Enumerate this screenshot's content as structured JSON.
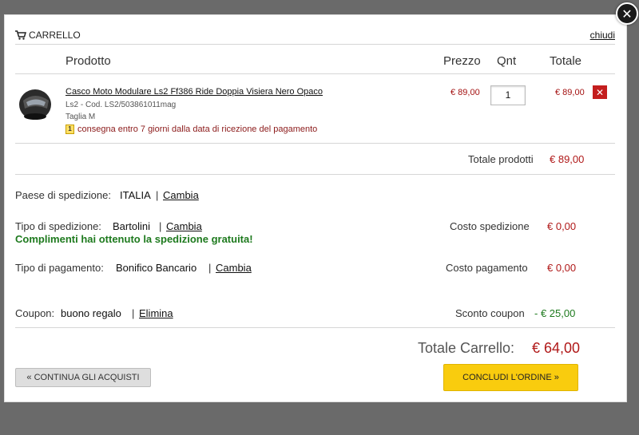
{
  "cart": {
    "title": "CARRELLO",
    "close_link": "chiudi",
    "close_button": "✕"
  },
  "columns": {
    "product": "Prodotto",
    "price": "Prezzo",
    "qty": "Qnt",
    "total": "Totale"
  },
  "item": {
    "name": "Casco Moto Modulare Ls2 Ff386 Ride Doppia Visiera Nero Opaco",
    "code": "Ls2 - Cod. LS2/503861011mag",
    "size": "Taglia M",
    "delivery_icon_label": "1",
    "delivery": "consegna entro 7 giorni dalla data di ricezione del pagamento",
    "price": "€ 89,00",
    "quantity": "1",
    "total": "€ 89,00",
    "remove_icon": "✕"
  },
  "summary": {
    "products_total_label": "Totale prodotti",
    "products_total": "€ 89,00",
    "shipping_country_label": "Paese di spedizione:",
    "shipping_country": "ITALIA",
    "change": "Cambia",
    "sep": "|",
    "shipping_type_label": "Tipo di spedizione:",
    "shipping_type": "Bartolini",
    "free_shipping_msg": "Complimenti hai ottenuto la spedizione gratuita!",
    "shipping_cost_label": "Costo spedizione",
    "shipping_cost": "€ 0,00",
    "payment_type_label": "Tipo di pagamento:",
    "payment_type": "Bonifico Bancario",
    "payment_cost_label": "Costo pagamento",
    "payment_cost": "€ 0,00",
    "coupon_label": "Coupon:",
    "coupon": "buono regalo",
    "remove": "Elimina",
    "coupon_discount_label": "Sconto coupon",
    "coupon_discount": "- € 25,00",
    "grand_total_label": "Totale Carrello:",
    "grand_total": "€ 64,00"
  },
  "buttons": {
    "continue": "« CONTINUA GLI ACQUISTI",
    "checkout": "CONCLUDI L'ORDINE »"
  },
  "icons": {
    "cart": "cart-icon",
    "helmet": "helmet-thumbnail",
    "calendar": "calendar-icon",
    "close": "close-icon",
    "remove": "remove-icon"
  },
  "colors": {
    "price_red": "#a41212",
    "success_green": "#1e7a1e",
    "checkout_yellow": "#f9cc0e",
    "remove_red": "#c41e1e"
  }
}
